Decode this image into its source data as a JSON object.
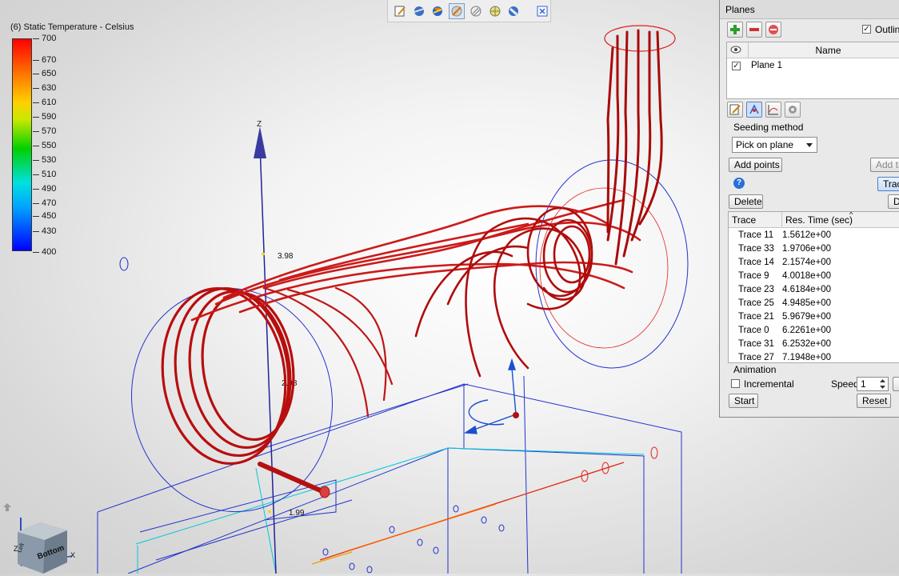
{
  "legend": {
    "title": "(6) Static Temperature -  Celsius",
    "ticks": [
      "700",
      "670",
      "650",
      "630",
      "610",
      "590",
      "570",
      "550",
      "530",
      "510",
      "490",
      "470",
      "450",
      "430",
      "400"
    ]
  },
  "viewport": {
    "axis_z_label": "Z",
    "dim_top": "3.98",
    "dim_mid": "2.98",
    "dim_bottom": "1.99",
    "cube_label_front": "Bottom",
    "cube_label_side": "Left",
    "cube_axis_x": "X",
    "cube_axis_z": "Z"
  },
  "toolbar": {
    "buttons": [
      "edit-icon",
      "shaded-sphere-icon",
      "colored-sphere-icon",
      "plane-pen-icon",
      "hatch-sphere-icon",
      "grid-sphere-icon",
      "glass-sphere-icon",
      "fit-view-icon"
    ]
  },
  "panel": {
    "title": "Planes",
    "outline_label": "Outline",
    "name_header": "Name",
    "plane_name": "Plane 1",
    "seeding_label": "Seeding method",
    "seeding_value": "Pick on plane",
    "add_points": "Add points",
    "add_trace": "Add tr",
    "trace_btn": "Trac",
    "delete_left": "Delete",
    "delete_right": "De",
    "col_trace": "Trace",
    "col_time": "Res. Time (sec)",
    "rows": [
      {
        "trace": "Trace 11",
        "time": "1.5612e+00"
      },
      {
        "trace": "Trace 33",
        "time": "1.9706e+00"
      },
      {
        "trace": "Trace 14",
        "time": "2.1574e+00"
      },
      {
        "trace": "Trace 9",
        "time": "4.0018e+00"
      },
      {
        "trace": "Trace 23",
        "time": "4.6184e+00"
      },
      {
        "trace": "Trace 25",
        "time": "4.9485e+00"
      },
      {
        "trace": "Trace 21",
        "time": "5.9679e+00"
      },
      {
        "trace": "Trace 0",
        "time": "6.2261e+00"
      },
      {
        "trace": "Trace 31",
        "time": "6.2532e+00"
      },
      {
        "trace": "Trace 27",
        "time": "7.1948e+00"
      }
    ],
    "animation_label": "Animation",
    "incremental_label": "Incremental",
    "speed_label": "Speed",
    "speed_value": "1",
    "start": "Start",
    "reset": "Reset"
  }
}
